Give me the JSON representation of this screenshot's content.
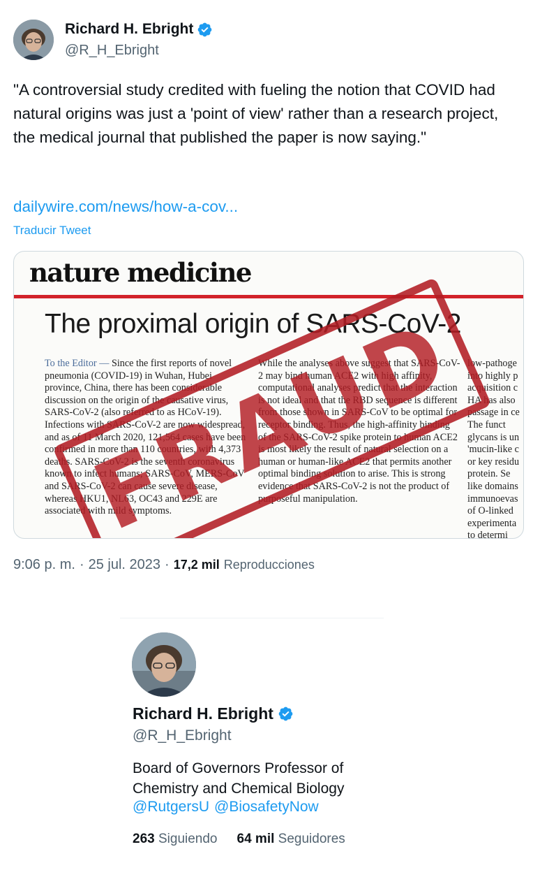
{
  "tweet": {
    "author": {
      "name": "Richard H. Ebright",
      "handle": "@R_H_Ebright",
      "verified_color": "#1d9bf0"
    },
    "text": "\"A controversial study credited with fueling the notion that COVID had natural origins was just a 'point of view' rather than a research project, the medical journal that published the paper is now saying.\"",
    "link": "dailywire.com/news/how-a-cov...",
    "translate_label": "Traducir Tweet",
    "media": {
      "journal": "nature medicine",
      "article_title": "The proximal origin of SARS-CoV-2",
      "stamp": "FRAUD",
      "col1_lead": "To the Editor —",
      "col1": " Since the first reports of novel pneumonia (COVID-19) in Wuhan, Hubei province, China, there has been considerable discussion on the origin of the causative virus, SARS-CoV-2 (also referred to as HCoV-19). Infections with SARS-CoV-2 are now widespread, and as of 11 March 2020, 121,564 cases have been confirmed in more than 110 countries, with 4,373 deaths. SARS-CoV-2 is the seventh coronavirus known to infect humans; SARS-CoV, MERS-CoV and SARS-CoV-2 can cause severe disease, whereas HKU1, NL63, OC43 and 229E are associated with mild symptoms.",
      "col2": "While the analyses above suggest that SARS-CoV-2 may bind human ACE2 with high affinity, computational analyses predict that the interaction is not ideal and that the RBD sequence is different from those shown in SARS-CoV to be optimal for receptor binding. Thus, the high-affinity binding of the SARS-CoV-2 spike protein to human ACE2 is most likely the result of natural selection on a human or human-like ACE2 that permits another optimal binding solution to arise. This is strong evidence that SARS-CoV-2 is not the product of purposeful manipulation.",
      "col3_lines": [
        "low-pathoge",
        "into highly p",
        "acquisition c",
        "HA has also",
        "passage in ce",
        "The funct",
        "glycans is un",
        "'mucin-like c",
        "or key residu",
        "protein. Se",
        "like domains",
        "immunoevas",
        "of O-linked",
        "experimenta",
        "to determi"
      ]
    },
    "time": "9:06 p. m.",
    "separator": "·",
    "date": "25 jul. 2023",
    "views_count": "17,2 mil",
    "views_label": "Reproducciones"
  },
  "profile_card": {
    "name": "Richard H. Ebright",
    "handle": "@R_H_Ebright",
    "bio": "Board of Governors Professor of Chemistry and Chemical Biology",
    "bio_links": [
      "@RutgersU",
      "@BiosafetyNow"
    ],
    "following_count": "263",
    "following_label": "Siguiendo",
    "followers_count": "64 mil",
    "followers_label": "Seguidores"
  },
  "colors": {
    "accent": "#1d9bf0",
    "text": "#0f1419",
    "muted": "#536471",
    "stamp_red": "#b21c23"
  }
}
